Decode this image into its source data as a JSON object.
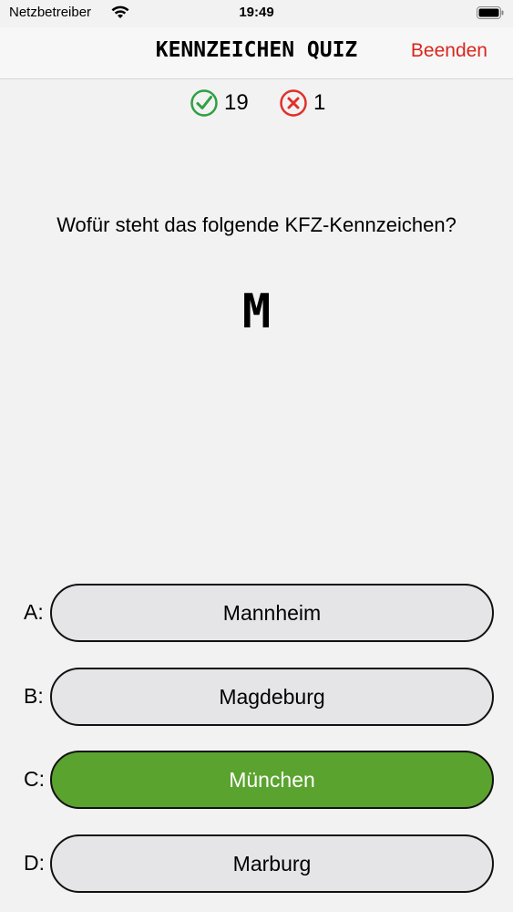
{
  "status_bar": {
    "carrier": "Netzbetreiber",
    "time": "19:49",
    "wifi_icon": "wifi-icon",
    "battery_icon": "battery-icon"
  },
  "nav": {
    "title": "KENNZEICHEN QUIZ",
    "quit_label": "Beenden"
  },
  "score": {
    "correct_count": "19",
    "wrong_count": "1",
    "correct_icon": "check-circle-icon",
    "wrong_icon": "x-circle-icon",
    "correct_color": "#2ea043",
    "wrong_color": "#e0302a"
  },
  "question": {
    "text": "Wofür steht das folgende KFZ-Kennzeichen?",
    "plate": "M"
  },
  "answers": [
    {
      "letter": "A:",
      "label": "Mannheim",
      "state": "neutral"
    },
    {
      "letter": "B:",
      "label": "Magdeburg",
      "state": "neutral"
    },
    {
      "letter": "C:",
      "label": "München",
      "state": "correct"
    },
    {
      "letter": "D:",
      "label": "Marburg",
      "state": "neutral"
    }
  ],
  "colors": {
    "accent_red": "#d8261e",
    "correct_green": "#5aa32f",
    "button_gray": "#e5e5e7"
  }
}
